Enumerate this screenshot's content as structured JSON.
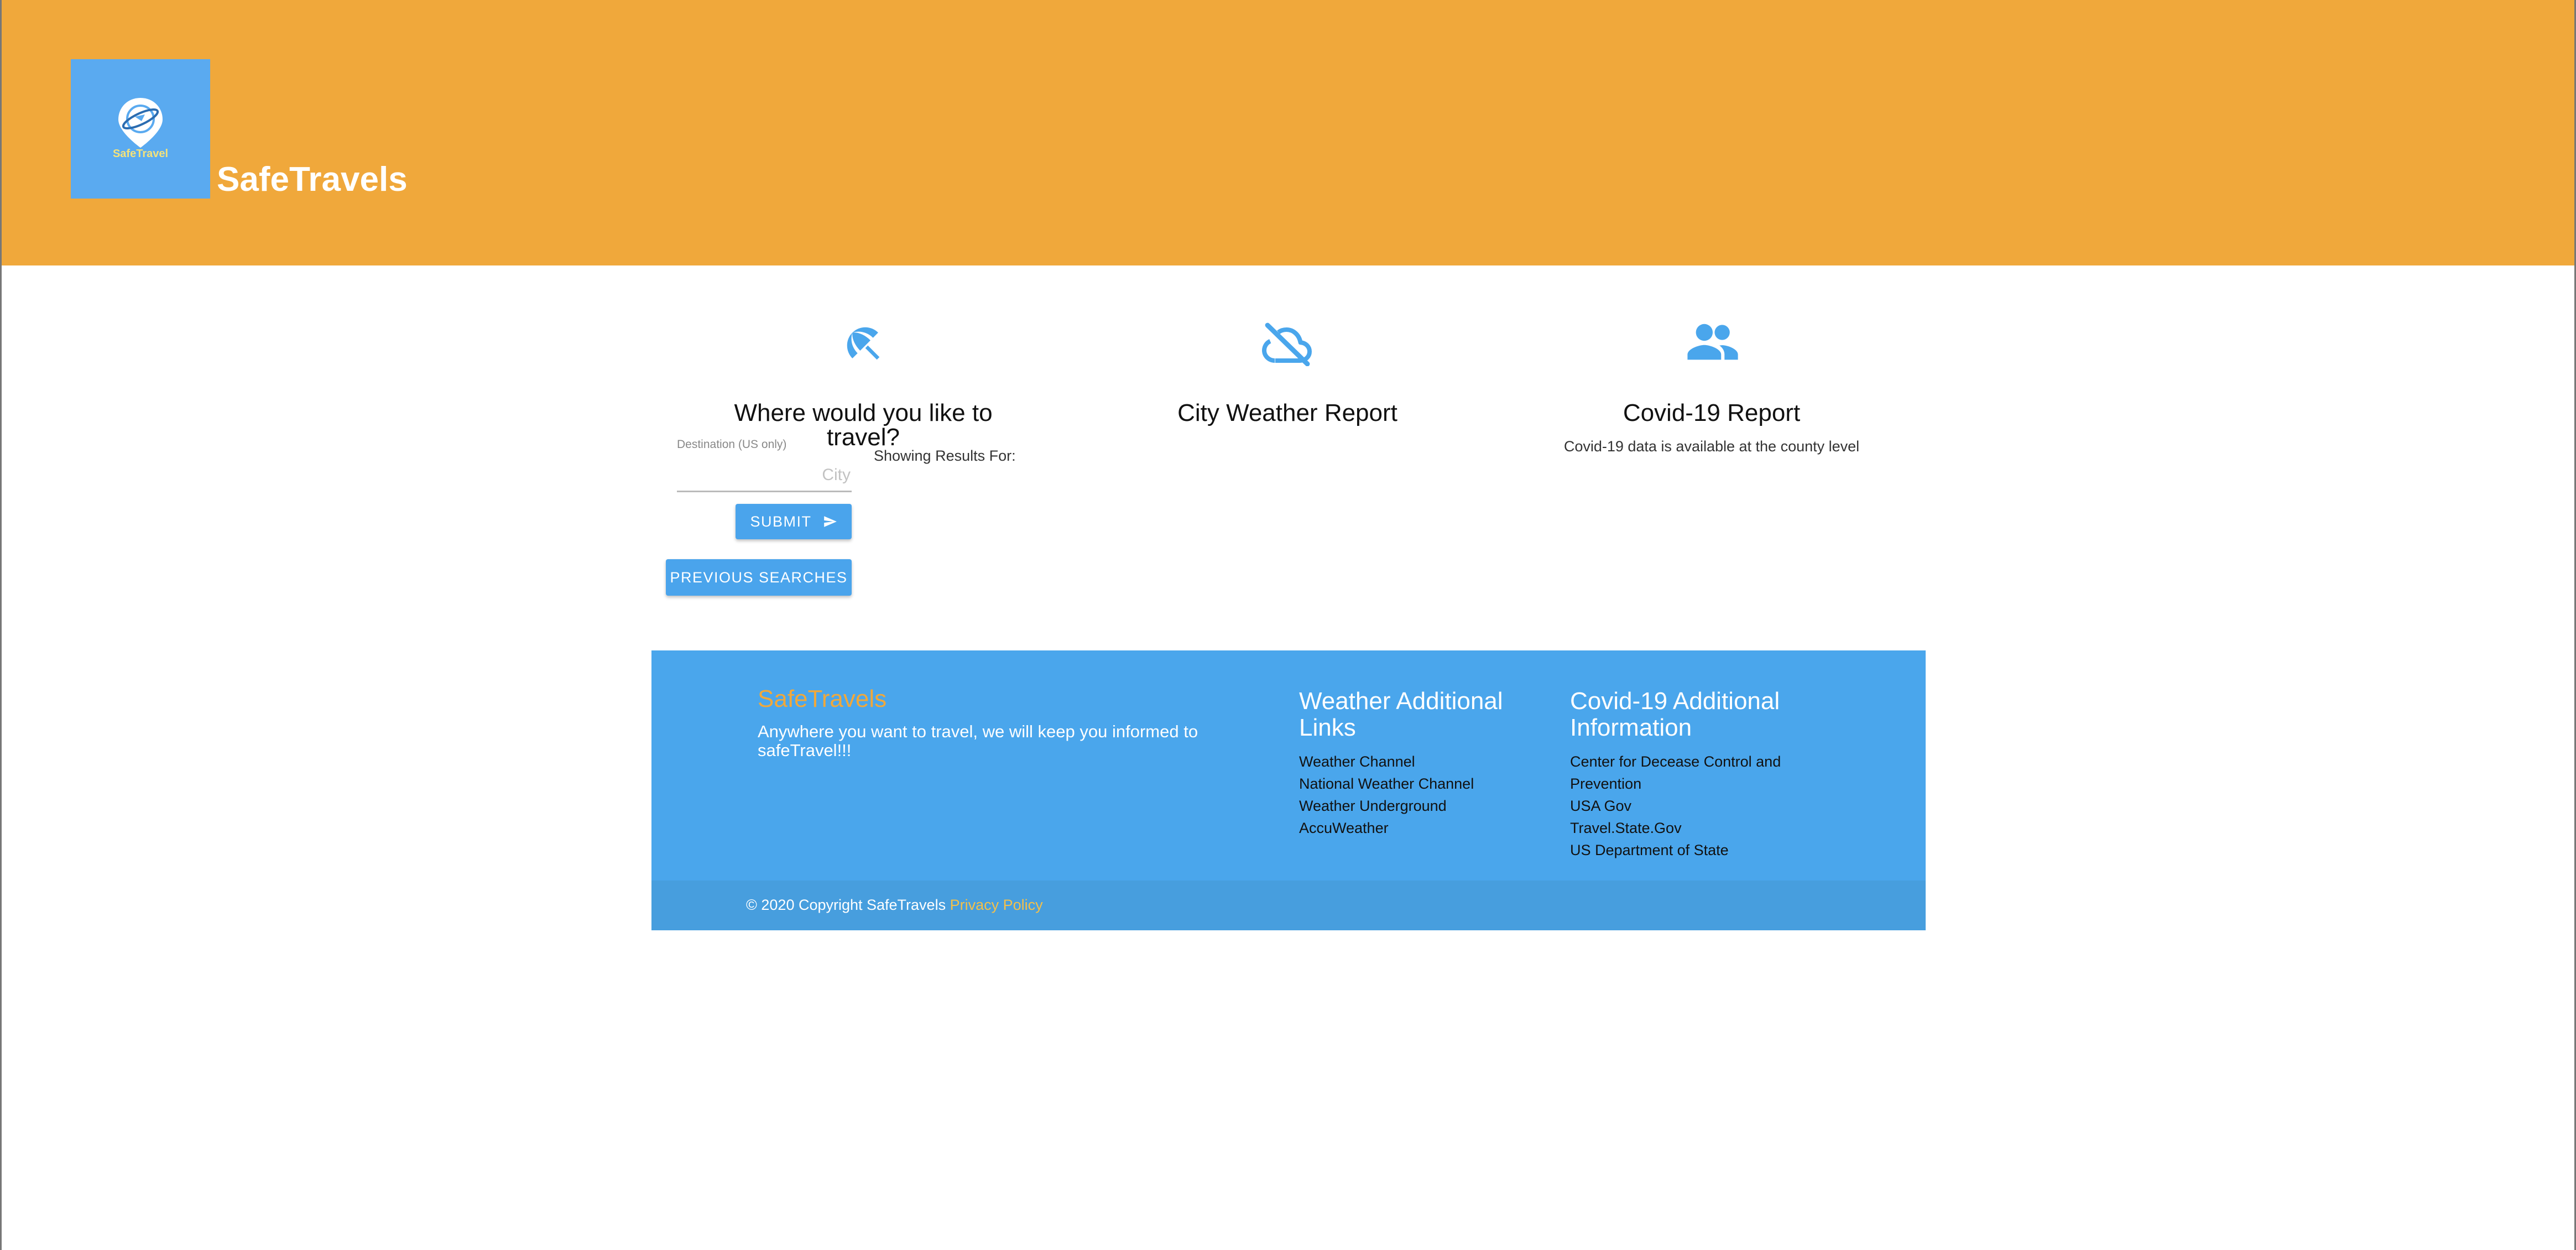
{
  "header": {
    "logo_text": "SafeTravel",
    "site_title": "SafeTravels"
  },
  "travel": {
    "icon": "beach-umbrella-off-icon",
    "title": "Where would you like to travel?",
    "input_label": "Destination (US only)",
    "input_placeholder": "City",
    "input_value": "",
    "showing_results": "Showing Results For:",
    "submit_label": "SUBMIT",
    "previous_label": "PREVIOUS SEARCHES"
  },
  "weather": {
    "icon": "cloud-off-icon",
    "title": "City Weather Report"
  },
  "covid": {
    "icon": "people-icon",
    "title": "Covid-19 Report",
    "note": "Covid-19 data is available at the county level"
  },
  "footer": {
    "brand": "SafeTravels",
    "tagline": "Anywhere you want to travel, we will keep you informed to safeTravel!!!",
    "weather_heading": "Weather Additional Links",
    "weather_links": [
      "Weather Channel",
      "National Weather Channel",
      "Weather Underground",
      "AccuWeather"
    ],
    "covid_heading": "Covid-19 Additional Information",
    "covid_links": [
      "Center for Decease Control and Prevention",
      "USA Gov",
      "Travel.State.Gov",
      "US Department of State"
    ],
    "copyright": "© 2020 Copyright SafeTravels",
    "privacy": "Privacy Policy"
  },
  "colors": {
    "header_bg": "#f0a83b",
    "accent_blue": "#4aa6ec",
    "brand_orange": "#f0a83b"
  }
}
